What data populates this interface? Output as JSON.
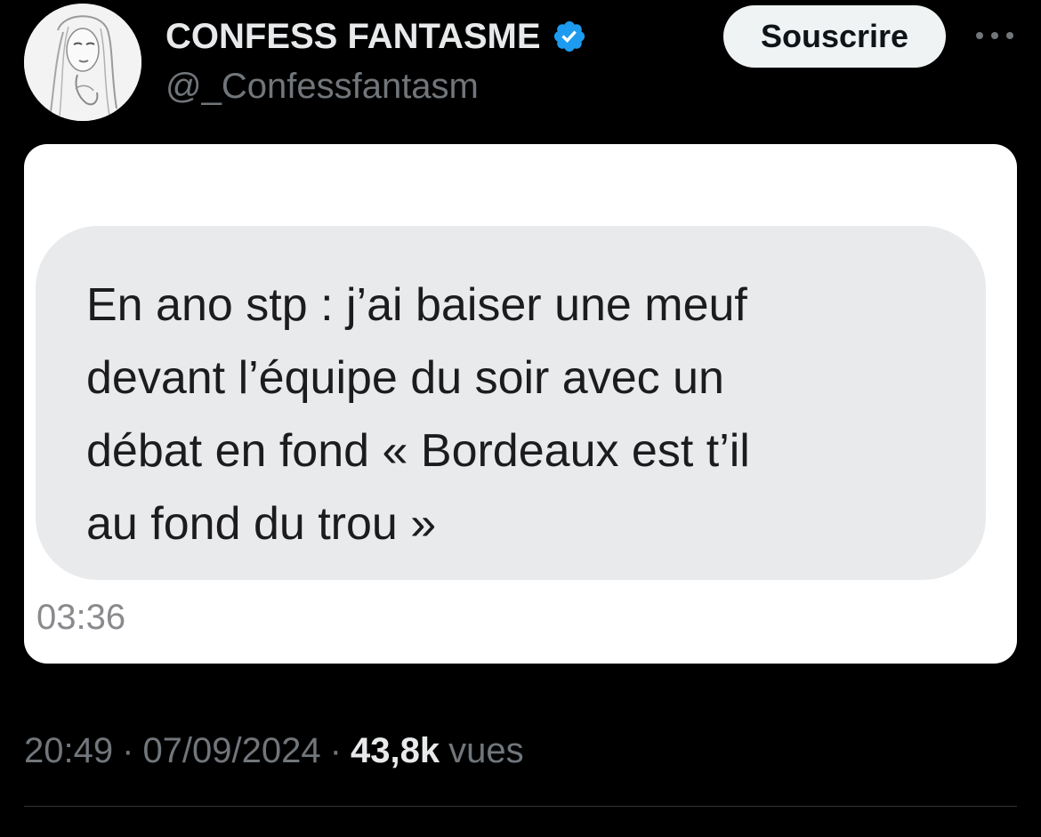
{
  "author": {
    "display_name": "CONFESS FANTASME",
    "handle": "@_Confessfantasm",
    "verified": true,
    "verified_color": "#1d9bf0"
  },
  "actions": {
    "subscribe_label": "Souscrire",
    "more_icon": "more-horizontal-icon"
  },
  "media": {
    "message_text": "En ano stp : j’ai baiser une meuf\ndevant l’équipe du soir avec un\ndébat en fond « Bordeaux  est t’il\nau fond du trou »",
    "message_time": "03:36"
  },
  "meta": {
    "time": "20:49",
    "sep1": "·",
    "date": "07/09/2024",
    "sep2": "·",
    "views_count": "43,8k",
    "views_label": "vues"
  },
  "colors": {
    "background": "#000000",
    "text_primary": "#e7e9ea",
    "text_secondary": "#71767b",
    "button_bg": "#eff3f4"
  }
}
